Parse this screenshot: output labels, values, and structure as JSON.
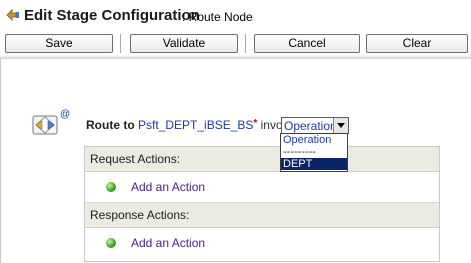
{
  "header": {
    "title": "Edit Stage Configuration",
    "subtitle": ": Route Node"
  },
  "toolbar": {
    "save_label": "Save",
    "validate_label": "Validate",
    "cancel_label": "Cancel",
    "clear_label": "Clear"
  },
  "route": {
    "label": "Route to",
    "service_link": "Psft_DEPT_iBSE_BS",
    "required_mark": "*",
    "invoking_label": "invoking",
    "operation_selected": "Operation",
    "operation_options": [
      "Operation",
      "---------",
      "DEPT"
    ],
    "highlighted_option": "DEPT",
    "at_sign": "@"
  },
  "request_actions": {
    "header": "Request Actions:",
    "add_action_label": "Add an Action"
  },
  "response_actions": {
    "header": "Response Actions:",
    "add_action_label": "Add an Action"
  },
  "colors": {
    "link": "#1d39a3",
    "section_header_bg": "#ebebe2",
    "dropdown_highlight": "#0a246a",
    "add_bullet": "#3aa31c"
  },
  "icons": {
    "title": "route-node-icon",
    "route": "envelope-route-icon",
    "dropdown": "chevron-down-icon",
    "add_action": "add-action-bullet-icon"
  }
}
